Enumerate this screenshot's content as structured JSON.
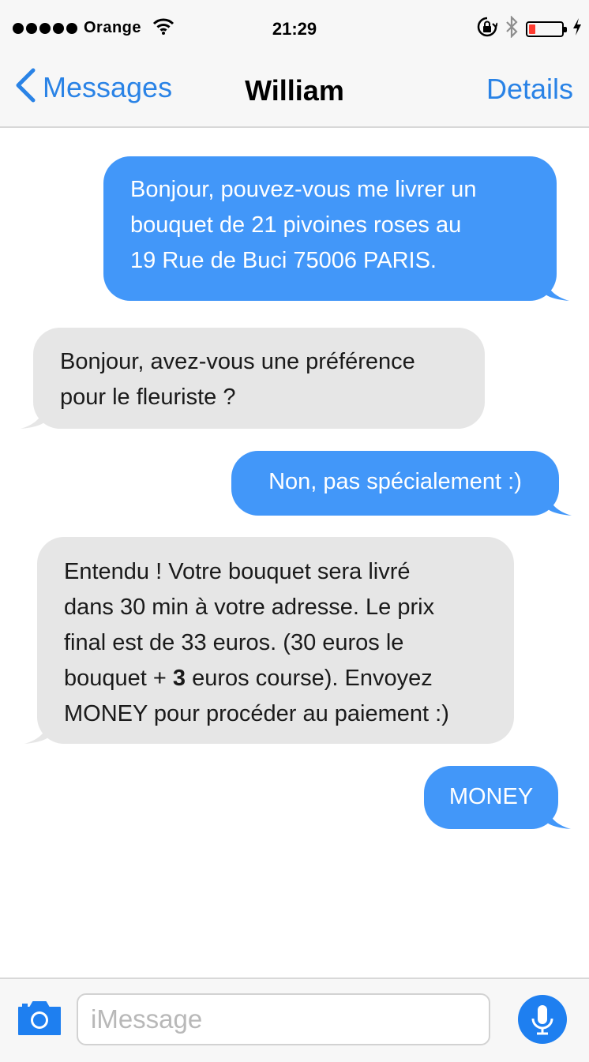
{
  "status_bar": {
    "carrier": "Orange",
    "time": "21:29",
    "battery_level": 0.2,
    "signal_dots": 5
  },
  "nav": {
    "back_label": "Messages",
    "title": "William",
    "details_label": "Details"
  },
  "messages": [
    {
      "direction": "outgoing",
      "text": "Bonjour, pouvez-vous me livrer un\nbouquet de 21 pivoines roses au\n19 Rue de Buci 75006 PARIS."
    },
    {
      "direction": "incoming",
      "text": "Bonjour, avez-vous une préférence\npour le fleuriste ?"
    },
    {
      "direction": "outgoing",
      "text": "Non, pas spécialement :)"
    },
    {
      "direction": "incoming",
      "text_before": "Entendu ! Votre bouquet sera livré\ndans 30 min à votre adresse. Le prix\nfinal est de 33 euros. (30 euros le\nbouquet + ",
      "text_bold": "3",
      "text_after": " euros course). Envoyez\nMONEY pour procéder au paiement :)"
    },
    {
      "direction": "outgoing",
      "text": "MONEY"
    }
  ],
  "composer": {
    "placeholder": "iMessage",
    "value": ""
  },
  "colors": {
    "accent": "#2a83e6",
    "outgoing_bubble": "#4297f9",
    "incoming_bubble": "#e6e6e6",
    "mic_button": "#1e7ff0",
    "battery_low": "#ff3b30"
  },
  "icons": [
    "signal-dots-icon",
    "wifi-icon",
    "rotation-lock-icon",
    "bluetooth-icon",
    "battery-icon",
    "charging-bolt-icon",
    "back-chevron-icon",
    "camera-icon",
    "microphone-icon"
  ]
}
